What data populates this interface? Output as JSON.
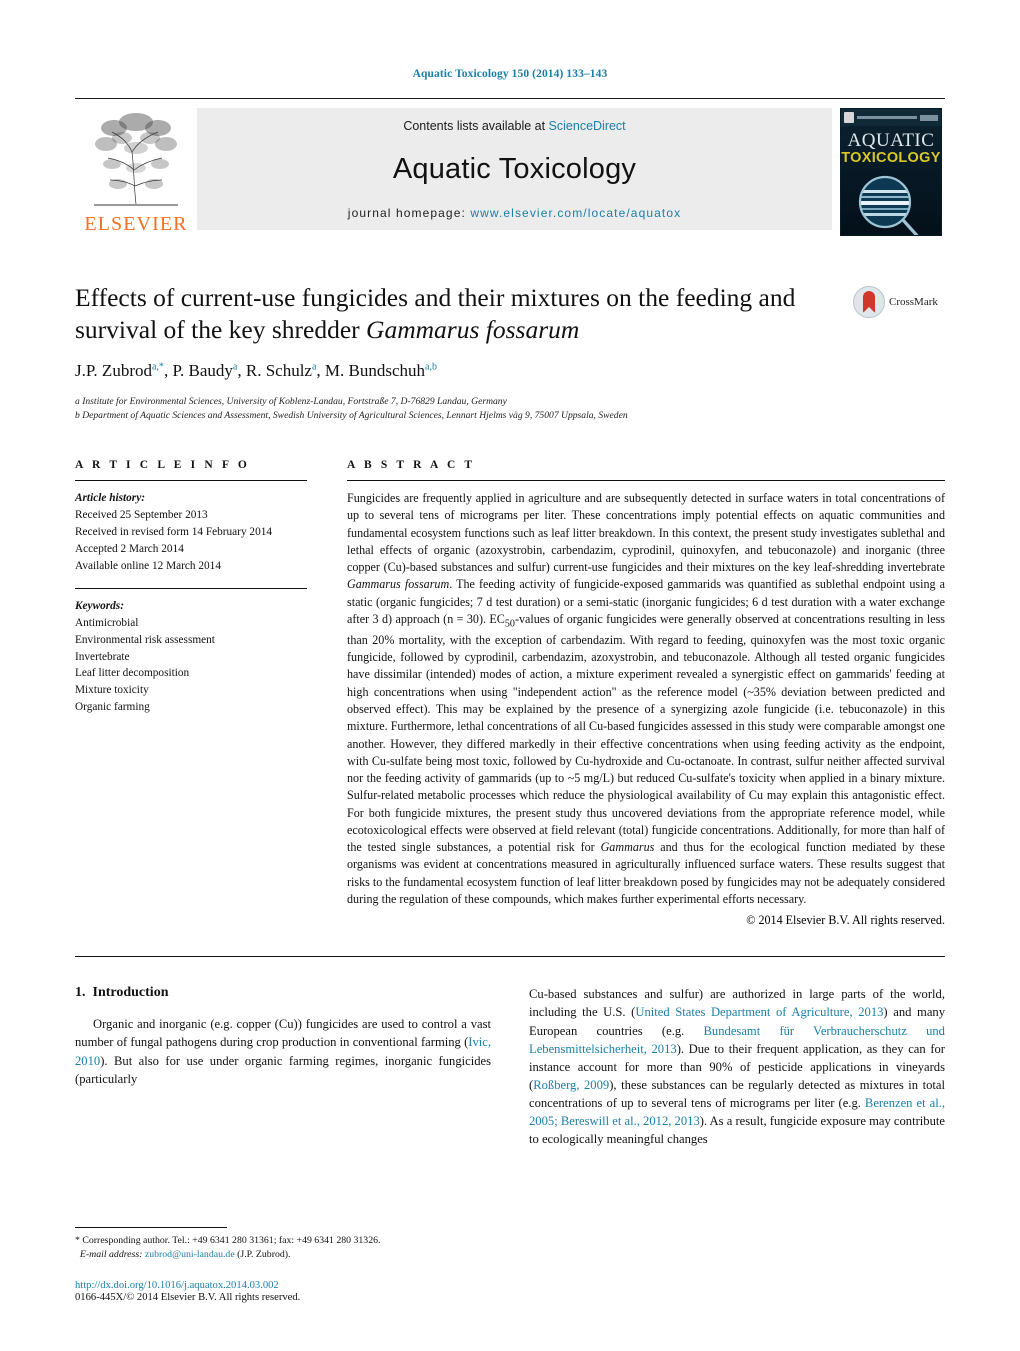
{
  "running_head": "Aquatic Toxicology 150 (2014) 133–143",
  "masthead": {
    "contents_prefix": "Contents lists available at ",
    "sciencedirect": "ScienceDirect",
    "journal_name": "Aquatic Toxicology",
    "homepage_label": "journal homepage:",
    "homepage_url": "www.elsevier.com/locate/aquatox",
    "publisher": "ELSEVIER",
    "cover": {
      "line1": "AQUATIC",
      "line2": "TOXICOLOGY"
    },
    "accent_color": "#1a7fa8",
    "elsevier_orange": "#f37021"
  },
  "article": {
    "title_part1": "Effects of current-use fungicides and their mixtures on the feeding and survival of the key shredder ",
    "title_italic": "Gammarus fossarum",
    "crossmark_label": "CrossMark",
    "authors_html": "J.P. Zubrod<sup>a,*</sup>, P. Baudy<sup>a</sup>, R. Schulz<sup>a</sup>, M. Bundschuh<sup>a,b</sup>",
    "affiliations": [
      "a Institute for Environmental Sciences, University of Koblenz-Landau, Fortstraße 7, D-76829 Landau, Germany",
      "b Department of Aquatic Sciences and Assessment, Swedish University of Agricultural Sciences, Lennart Hjelms väg 9, 75007 Uppsala, Sweden"
    ]
  },
  "article_info": {
    "heading": "A R T I C L E   I N F O",
    "history_label": "Article history:",
    "history": [
      "Received 25 September 2013",
      "Received in revised form 14 February 2014",
      "Accepted 2 March 2014",
      "Available online 12 March 2014"
    ],
    "keywords_label": "Keywords:",
    "keywords": [
      "Antimicrobial",
      "Environmental risk assessment",
      "Invertebrate",
      "Leaf litter decomposition",
      "Mixture toxicity",
      "Organic farming"
    ]
  },
  "abstract": {
    "heading": "A B S T R A C T",
    "p1": "Fungicides are frequently applied in agriculture and are subsequently detected in surface waters in total concentrations of up to several tens of micrograms per liter. These concentrations imply potential effects on aquatic communities and fundamental ecosystem functions such as leaf litter breakdown. In this context, the present study investigates sublethal and lethal effects of organic (azoxystrobin, carbendazim, cyprodinil, quinoxyfen, and tebuconazole) and inorganic (three copper (Cu)-based substances and sulfur) current-use fungicides and their mixtures on the key leaf-shredding invertebrate ",
    "species1": "Gammarus fossarum",
    "p2": ". The feeding activity of fungicide-exposed gammarids was quantified as sublethal endpoint using a static (organic fungicides; 7 d test duration) or a semi-static (inorganic fungicides; 6 d test duration with a water exchange after 3 d) approach (n = 30). EC",
    "sub50": "50",
    "p3": "-values of organic fungicides were generally observed at concentrations resulting in less than 20% mortality, with the exception of carbendazim. With regard to feeding, quinoxyfen was the most toxic organic fungicide, followed by cyprodinil, carbendazim, azoxystrobin, and tebuconazole. Although all tested organic fungicides have dissimilar (intended) modes of action, a mixture experiment revealed a synergistic effect on gammarids' feeding at high concentrations when using \"independent action\" as the reference model (~35% deviation between predicted and observed effect). This may be explained by the presence of a synergizing azole fungicide (i.e. tebuconazole) in this mixture. Furthermore, lethal concentrations of all Cu-based fungicides assessed in this study were comparable amongst one another. However, they differed markedly in their effective concentrations when using feeding activity as the endpoint, with Cu-sulfate being most toxic, followed by Cu-hydroxide and Cu-octanoate. In contrast, sulfur neither affected survival nor the feeding activity of gammarids (up to ~5 mg/L) but reduced Cu-sulfate's toxicity when applied in a binary mixture. Sulfur-related metabolic processes which reduce the physiological availability of Cu may explain this antagonistic effect. For both fungicide mixtures, the present study thus uncovered deviations from the appropriate reference model, while ecotoxicological effects were observed at field relevant (total) fungicide concentrations. Additionally, for more than half of the tested single substances, a potential risk for ",
    "species2": "Gammarus",
    "p4": " and thus for the ecological function mediated by these organisms was evident at concentrations measured in agriculturally influenced surface waters. These results suggest that risks to the fundamental ecosystem function of leaf litter breakdown posed by fungicides may not be adequately considered during the regulation of these compounds, which makes further experimental efforts necessary.",
    "copyright": "© 2014 Elsevier B.V. All rights reserved."
  },
  "introduction": {
    "number": "1.",
    "title": "Introduction",
    "left_p1_a": "Organic and inorganic (e.g. copper (Cu)) fungicides are used to control a vast number of fungal pathogens during crop production in conventional farming (",
    "left_ref1": "Ivic, 2010",
    "left_p1_b": "). But also for use under organic farming regimes, inorganic fungicides (particularly",
    "right_p1_a": "Cu-based substances and sulfur) are authorized in large parts of the world, including the U.S. (",
    "right_ref1": "United States Department of Agriculture, 2013",
    "right_p1_b": ") and many European countries (e.g. ",
    "right_ref2": "Bundesamt für Verbraucherschutz und Lebensmittelsicherheit, 2013",
    "right_p1_c": "). Due to their frequent application, as they can for instance account for more than 90% of pesticide applications in vineyards (",
    "right_ref3": "Roßberg, 2009",
    "right_p1_d": "), these substances can be regularly detected as mixtures in total concentrations of up to several tens of micrograms per liter (e.g. ",
    "right_ref4": "Berenzen et al., 2005; Bereswill et al., 2012, 2013",
    "right_p1_e": "). As a result, fungicide exposure may contribute to ecologically meaningful changes"
  },
  "footer": {
    "corresponding_mark": "*",
    "corresponding_text": "Corresponding author. Tel.: +49 6341 280 31361; fax: +49 6341 280 31326.",
    "email_label": "E-mail address:",
    "email": "zubrod@uni-landau.de",
    "email_suffix": "(J.P. Zubrod).",
    "doi": "http://dx.doi.org/10.1016/j.aquatox.2014.03.002",
    "issn": "0166-445X/© 2014 Elsevier B.V. All rights reserved."
  }
}
